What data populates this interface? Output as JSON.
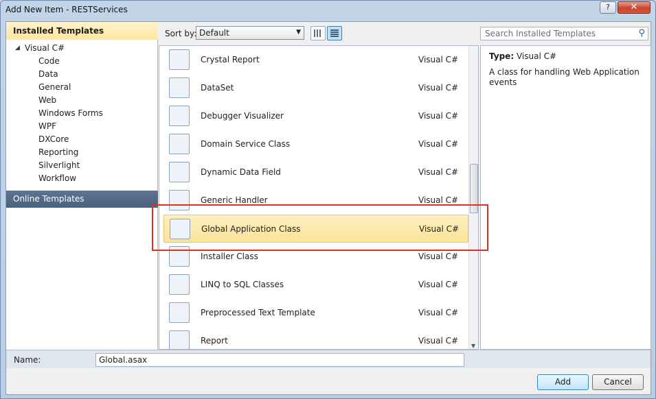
{
  "window": {
    "title": "Add New Item - RESTServices",
    "help": "?",
    "close": "✕"
  },
  "left": {
    "installed_header": "Installed Templates",
    "root": "Visual C#",
    "items": [
      "Code",
      "Data",
      "General",
      "Web",
      "Windows Forms",
      "WPF",
      "DXCore",
      "Reporting",
      "Silverlight",
      "Workflow"
    ],
    "online_header": "Online Templates"
  },
  "toolbar": {
    "sort_label": "Sort by:",
    "sort_value": "Default",
    "search_placeholder": "Search Installed Templates"
  },
  "templates": [
    {
      "name": "Crystal Report",
      "lang": "Visual C#"
    },
    {
      "name": "DataSet",
      "lang": "Visual C#"
    },
    {
      "name": "Debugger Visualizer",
      "lang": "Visual C#"
    },
    {
      "name": "Domain Service Class",
      "lang": "Visual C#"
    },
    {
      "name": "Dynamic Data Field",
      "lang": "Visual C#"
    },
    {
      "name": "Generic Handler",
      "lang": "Visual C#"
    },
    {
      "name": "Global Application Class",
      "lang": "Visual C#"
    },
    {
      "name": "Installer Class",
      "lang": "Visual C#"
    },
    {
      "name": "LINQ to SQL Classes",
      "lang": "Visual C#"
    },
    {
      "name": "Preprocessed Text Template",
      "lang": "Visual C#"
    },
    {
      "name": "Report",
      "lang": "Visual C#"
    }
  ],
  "info": {
    "type_label": "Type:",
    "type_value": "Visual C#",
    "description": "A class for handling Web Application events"
  },
  "bottom": {
    "name_label": "Name:",
    "name_value": "Global.asax",
    "add": "Add",
    "cancel": "Cancel"
  },
  "colors": {
    "selection": "#fbe29a",
    "highlight": "#e0301e",
    "online_header": "#4a617c"
  }
}
